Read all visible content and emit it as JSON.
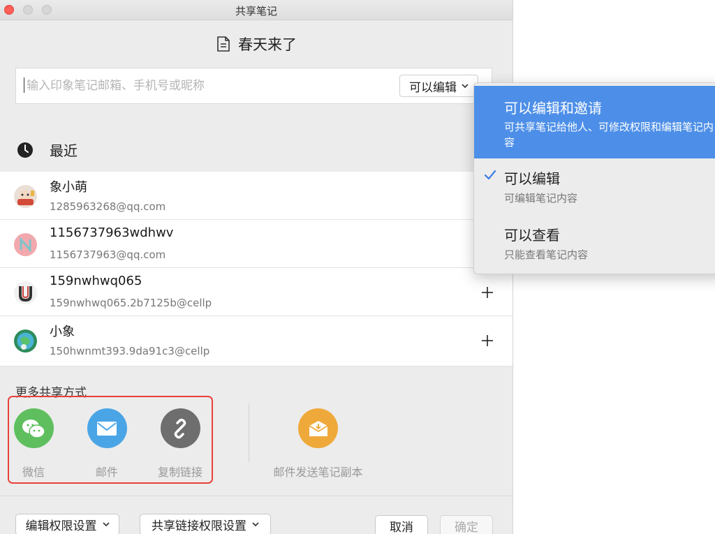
{
  "window": {
    "title": "共享笔记"
  },
  "note": {
    "title": "春天来了"
  },
  "invite": {
    "placeholder": "输入印象笔记邮箱、手机号或昵称",
    "value": "",
    "permission": "可以编辑"
  },
  "recent": {
    "label": "最近",
    "contacts": [
      {
        "name": "象小萌",
        "email": "1285963268@qq.com",
        "show_add": false
      },
      {
        "name": "1156737963wdhwv",
        "email": "1156737963@qq.com",
        "show_add": false
      },
      {
        "name": "159nwhwq065",
        "email": "159nwhwq065.2b7125b@cellp",
        "show_add": true
      },
      {
        "name": "小象",
        "email": "150hwnmt393.9da91c3@cellp",
        "show_add": true
      }
    ]
  },
  "more_share": {
    "title": "更多共享方式",
    "wechat": "微信",
    "mail": "邮件",
    "copy_link": "复制链接",
    "email_copy": "邮件发送笔记副本"
  },
  "footer": {
    "edit_permission": "编辑权限设置",
    "link_permission": "共享链接权限设置",
    "cancel": "取消",
    "confirm": "确定"
  },
  "permission_menu": {
    "options": [
      {
        "title": "可以编辑和邀请",
        "desc": "可共享笔记给他人、可修改权限和编辑笔记内容"
      },
      {
        "title": "可以编辑",
        "desc": "可编辑笔记内容"
      },
      {
        "title": "可以查看",
        "desc": "只能查看笔记内容"
      }
    ]
  },
  "colors": {
    "accent_blue": "#4d8fe8",
    "wechat_green": "#5fbf5f",
    "mail_blue": "#4aa5e6",
    "link_gray": "#6e6e6e",
    "copy_orange": "#efa93b",
    "highlight_red": "#e8413a"
  }
}
